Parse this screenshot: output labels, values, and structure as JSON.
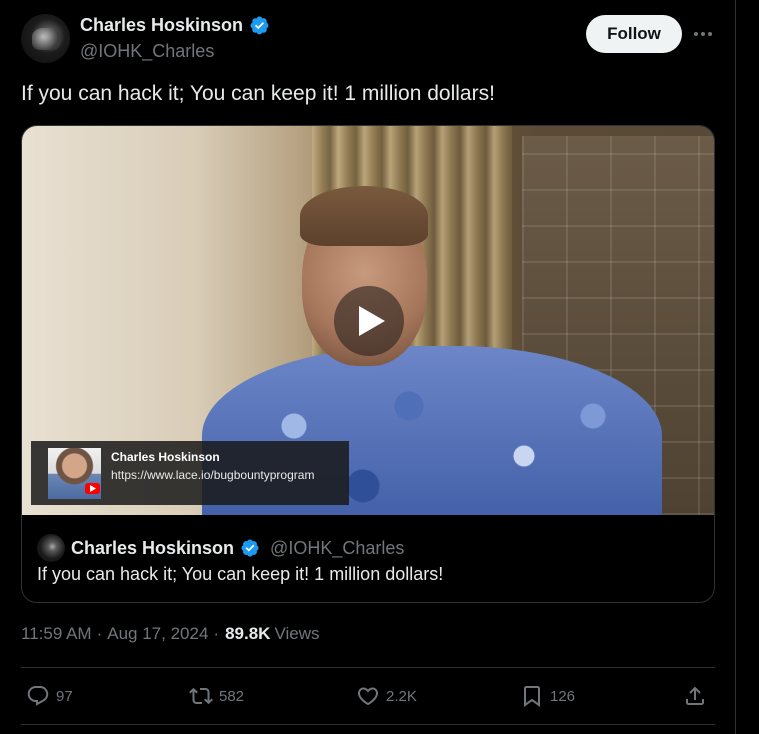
{
  "author": {
    "display_name": "Charles Hoskinson",
    "handle": "@IOHK_Charles",
    "verified": true
  },
  "header": {
    "follow_label": "Follow"
  },
  "tweet": {
    "text": "If you can hack it; You can keep it! 1 million dollars!",
    "time": "11:59 AM",
    "separator1": "·",
    "date": "Aug 17, 2024",
    "separator2": "·",
    "views_count": "89.8K",
    "views_label": "Views"
  },
  "video_overlay": {
    "channel_name": "Charles Hoskinson",
    "url": "https://www.lace.io/bugbountyprogram"
  },
  "quoted_tweet": {
    "display_name": "Charles Hoskinson",
    "handle": "@IOHK_Charles",
    "text": "If you can hack it; You can keep it! 1 million dollars!"
  },
  "actions": {
    "replies": "97",
    "reposts": "582",
    "likes": "2.2K",
    "bookmarks": "126"
  },
  "colors": {
    "background": "#000000",
    "text": "#e7e9ea",
    "secondary_text": "#71767b",
    "verified_blue": "#1d9bf0",
    "border": "#2f3336"
  }
}
